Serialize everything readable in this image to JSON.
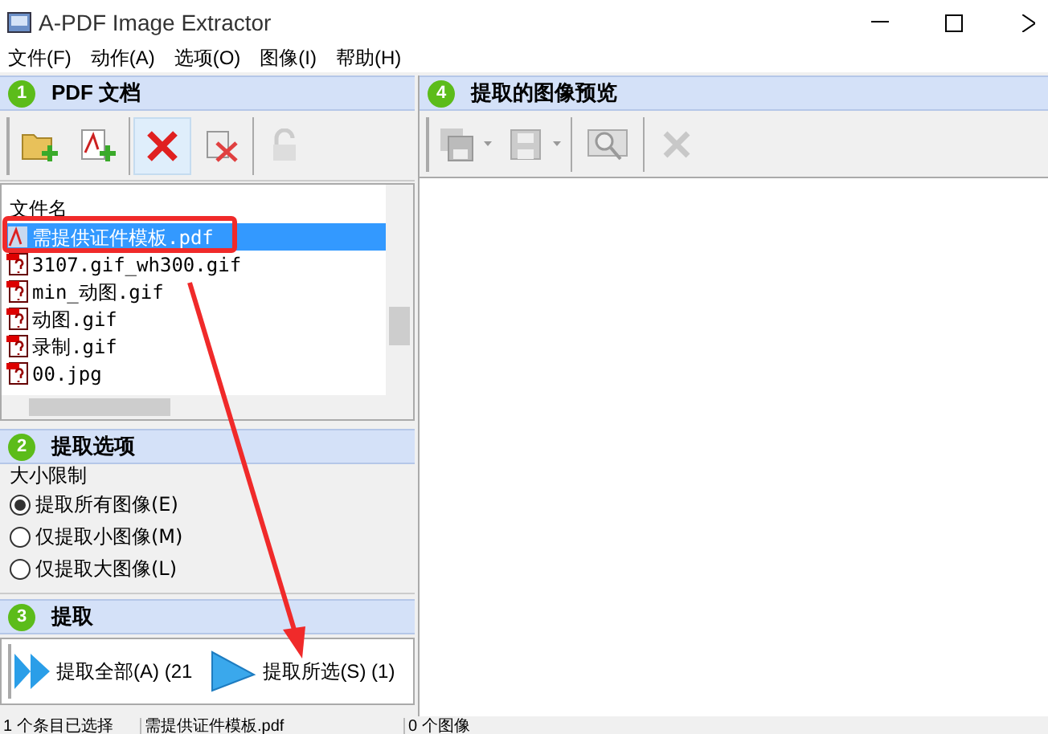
{
  "window": {
    "title": "A-PDF Image Extractor"
  },
  "menu": [
    "文件(F)",
    "动作(A)",
    "选项(O)",
    "图像(I)",
    "帮助(H)"
  ],
  "pdf_panel": {
    "number": "1",
    "title": "PDF 文档",
    "column": "文件名",
    "files": [
      {
        "name": "需提供证件模板.pdf",
        "kind": "pdf",
        "selected": true
      },
      {
        "name": "3107.gif_wh300.gif",
        "kind": "image",
        "selected": false
      },
      {
        "name": "min_动图.gif",
        "kind": "image",
        "selected": false
      },
      {
        "name": "动图.gif",
        "kind": "image",
        "selected": false
      },
      {
        "name": "录制.gif",
        "kind": "image",
        "selected": false
      },
      {
        "name": "00.jpg",
        "kind": "image",
        "selected": false
      }
    ]
  },
  "options_panel": {
    "number": "2",
    "title": "提取选项",
    "group": "大小限制",
    "radios": [
      {
        "label": "提取所有图像(E)",
        "selected": true
      },
      {
        "label": "仅提取小图像(M)",
        "selected": false
      },
      {
        "label": "仅提取大图像(L)",
        "selected": false
      }
    ]
  },
  "extract_panel": {
    "number": "3",
    "title": "提取",
    "buttons": [
      {
        "label": "提取全部(A) (21",
        "kind": "all"
      },
      {
        "label": "提取所选(S) (1)",
        "kind": "selected"
      }
    ]
  },
  "preview_panel": {
    "number": "4",
    "title": "提取的图像预览"
  },
  "status_bar": [
    "1 个条目已选择",
    "需提供证件模板.pdf",
    "0 个图像"
  ]
}
